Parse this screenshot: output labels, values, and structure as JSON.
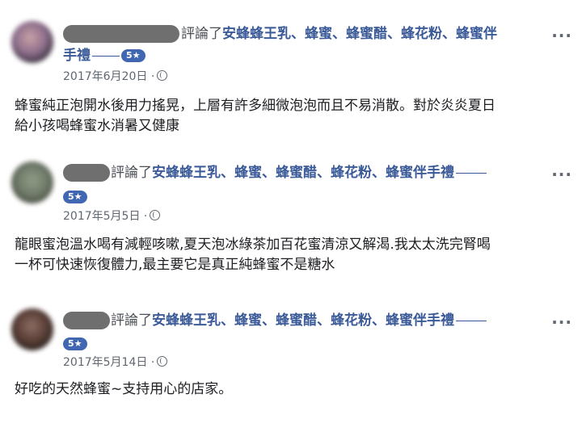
{
  "reviews": [
    {
      "verb": "評論了",
      "product_line1": "安蜂蜂王乳、蜂蜜、蜂蜜醋、蜂花粉、蜂蜜伴",
      "product_line2": "手禮",
      "badge": "5★",
      "date": "2017年6月20日",
      "separator": "·",
      "more": "···",
      "text_line1": "蜂蜜純正泡開水後用力搖晃，上層有許多細微泡泡而且不易消散。對於炎炎夏日",
      "text_line2": "給小孩喝蜂蜜水消暑又健康"
    },
    {
      "verb": "評論了",
      "product_line1": "安蜂蜂王乳、蜂蜜、蜂蜜醋、蜂花粉、蜂蜜伴手禮",
      "product_line2": "",
      "badge": "5★",
      "date": "2017年5月5日",
      "separator": "·",
      "more": "···",
      "text_line1": "龍眼蜜泡溫水喝有減輕咳嗽,夏天泡冰綠茶加百花蜜清涼又解渴.我太太洗完腎喝",
      "text_line2": "一杯可快速恢復體力,最主要它是真正純蜂蜜不是糖水"
    },
    {
      "verb": "評論了",
      "product_line1": "安蜂蜂王乳、蜂蜜、蜂蜜醋、蜂花粉、蜂蜜伴手禮",
      "product_line2": "",
      "badge": "5★",
      "date": "2017年5月14日",
      "separator": "·",
      "more": "···",
      "text_line1": "好吃的天然蜂蜜~支持用心的店家。",
      "text_line2": ""
    }
  ]
}
